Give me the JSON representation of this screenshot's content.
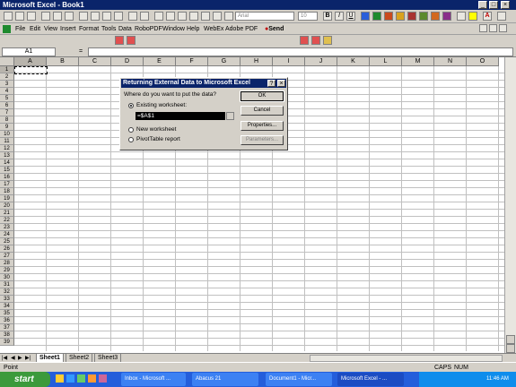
{
  "window": {
    "title": "Microsoft Excel - Book1",
    "min": "_",
    "max": "□",
    "close": "×"
  },
  "menus": [
    "File",
    "Edit",
    "View",
    "Insert",
    "Format",
    "Tools",
    "Data",
    "RoboPDF",
    "Window",
    "Help",
    "WebEx",
    "Adobe PDF"
  ],
  "send_label": "Send",
  "formula": {
    "namebox": "A1",
    "equals": "="
  },
  "columns": [
    "A",
    "B",
    "C",
    "D",
    "E",
    "F",
    "G",
    "H",
    "I",
    "J",
    "K",
    "L",
    "M",
    "N",
    "O"
  ],
  "rows": [
    "1",
    "2",
    "3",
    "4",
    "5",
    "6",
    "7",
    "8",
    "9",
    "10",
    "11",
    "12",
    "13",
    "14",
    "15",
    "16",
    "17",
    "18",
    "19",
    "20",
    "21",
    "22",
    "23",
    "24",
    "25",
    "26",
    "27",
    "28",
    "29",
    "30",
    "31",
    "32",
    "33",
    "34",
    "35",
    "36",
    "37",
    "38",
    "39"
  ],
  "font_box": "Arial",
  "size_box": "10",
  "dialog": {
    "title": "Returning External Data to Microsoft Excel",
    "prompt": "Where do you want to put the data?",
    "existing": "Existing worksheet:",
    "range": "=$A$1",
    "new": "New worksheet",
    "pivot": "PivotTable report",
    "ok": "OK",
    "cancel": "Cancel",
    "properties": "Properties...",
    "parameters": "Parameters..."
  },
  "sheets": [
    "Sheet1",
    "Sheet2",
    "Sheet3"
  ],
  "status": {
    "mode": "Point",
    "caps": "CAPS",
    "num": "NUM"
  },
  "taskbar": {
    "start": "start",
    "items": [
      "Inbox - Microsoft ...",
      "Abacus 21",
      "Document1 - Micr...",
      "Microsoft Excel - ..."
    ],
    "clock": "11:46 AM"
  }
}
